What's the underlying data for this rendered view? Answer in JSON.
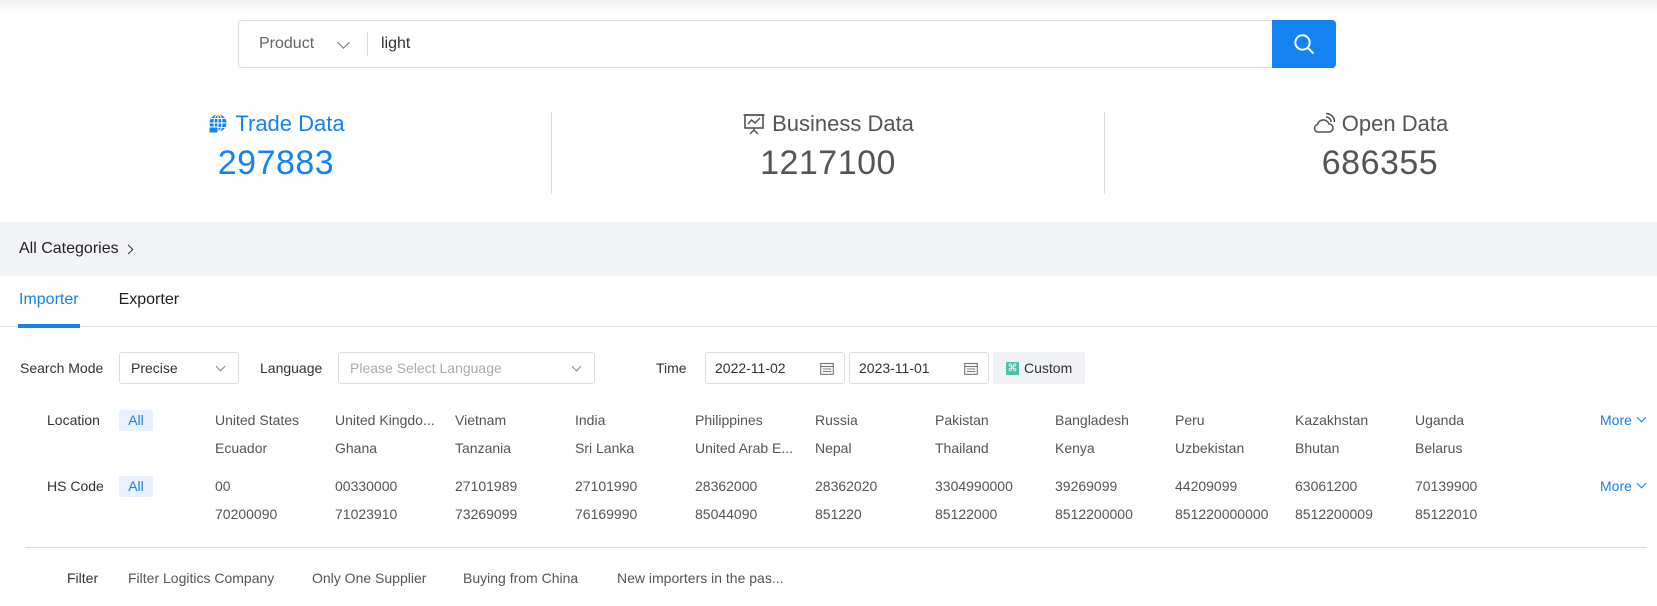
{
  "search": {
    "type_selected": "Product",
    "query": "light"
  },
  "stats": [
    {
      "label": "Trade Data",
      "value": "297883",
      "icon": "globe-trade-icon",
      "active": true
    },
    {
      "label": "Business Data",
      "value": "1217100",
      "icon": "presentation-board-icon",
      "active": false
    },
    {
      "label": "Open Data",
      "value": "686355",
      "icon": "cloud-signal-icon",
      "active": false
    }
  ],
  "categories": {
    "label": "All Categories"
  },
  "tabs": [
    {
      "label": "Importer",
      "active": true
    },
    {
      "label": "Exporter",
      "active": false
    }
  ],
  "filters": {
    "search_mode": {
      "label": "Search Mode",
      "value": "Precise"
    },
    "language": {
      "label": "Language",
      "placeholder": "Please Select Language"
    },
    "time": {
      "label": "Time",
      "start": "2022-11-02",
      "end": "2023-11-01",
      "custom_label": "Custom"
    }
  },
  "location": {
    "label": "Location",
    "all_label": "All",
    "more_label": "More",
    "row1": [
      "United States",
      "United Kingdo...",
      "Vietnam",
      "India",
      "Philippines",
      "Russia",
      "Pakistan",
      "Bangladesh",
      "Peru",
      "Kazakhstan",
      "Uganda"
    ],
    "row2": [
      "Ecuador",
      "Ghana",
      "Tanzania",
      "Sri Lanka",
      "United Arab E...",
      "Nepal",
      "Thailand",
      "Kenya",
      "Uzbekistan",
      "Bhutan",
      "Belarus"
    ]
  },
  "hs_code": {
    "label": "HS Code",
    "all_label": "All",
    "more_label": "More",
    "row1": [
      "00",
      "00330000",
      "27101989",
      "27101990",
      "28362000",
      "28362020",
      "3304990000",
      "39269099",
      "44209099",
      "63061200",
      "70139900"
    ],
    "row2": [
      "70200090",
      "71023910",
      "73269099",
      "76169990",
      "85044090",
      "851220",
      "85122000",
      "8512200000",
      "851220000000",
      "8512200009",
      "85122010"
    ]
  },
  "extra_filters": {
    "label": "Filter",
    "options": [
      "Filter Logitics Company",
      "Only One Supplier",
      "Buying from China",
      "New importers in the pas..."
    ]
  },
  "colors": {
    "accent": "#1482f0",
    "category_bar_bg": "#f3f4f7",
    "chip_bg": "#e8f1fd"
  }
}
